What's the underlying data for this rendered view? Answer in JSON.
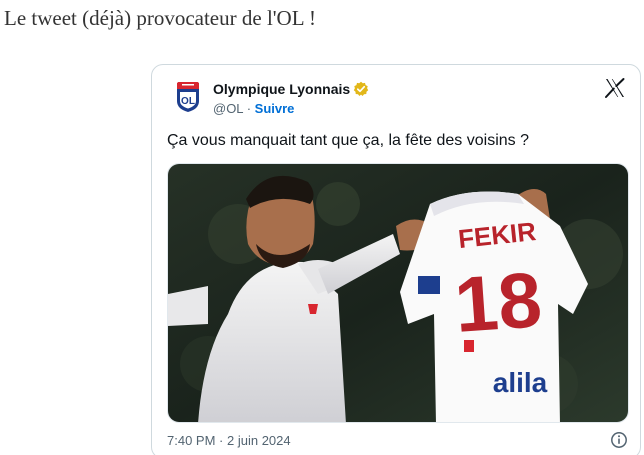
{
  "article": {
    "headline": "Le tweet (déjà) provocateur de l'OL !"
  },
  "tweet": {
    "author": {
      "display_name": "Olympique Lyonnais",
      "handle": "@OL",
      "separator": "·",
      "follow_label": "Suivre",
      "verified": true,
      "avatar_icon": "ol-crest-icon"
    },
    "text": "Ça vous manquait tant que ça, la fête des voisins ?",
    "media": {
      "shirt_name": "FEKIR",
      "shirt_number": "18",
      "sponsor": "alila",
      "description_icon": "player-holding-jersey-photo"
    },
    "time": "7:40 PM",
    "date_separator": "·",
    "date": "2 juin 2024",
    "platform_icon": "x-logo-icon",
    "info_icon": "info-icon"
  },
  "colors": {
    "link": "#006fd6",
    "verified_badge": "#e2b719",
    "text_primary": "#0f1419",
    "text_secondary": "#536471",
    "border": "#cfd9de"
  }
}
